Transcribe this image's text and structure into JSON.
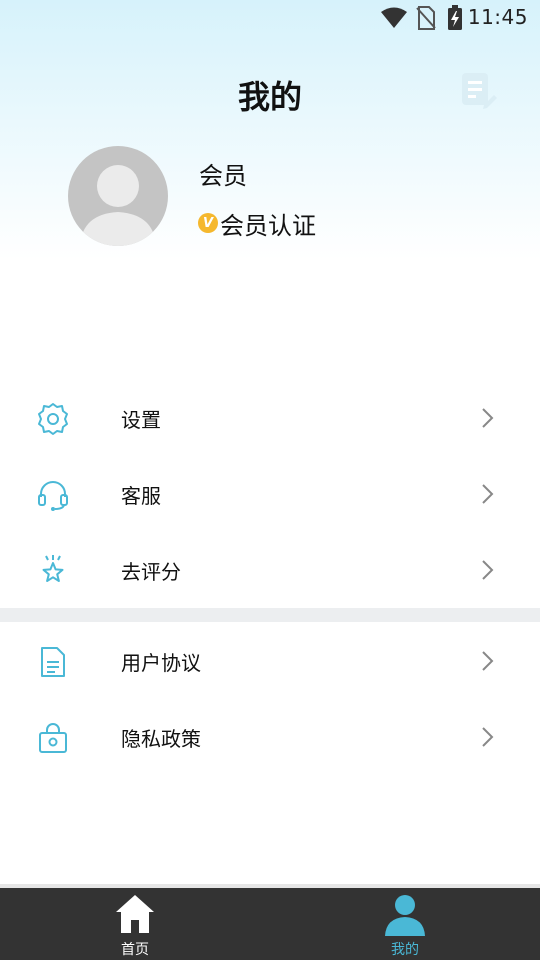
{
  "status_bar": {
    "time": "11:45"
  },
  "header": {
    "title": "我的"
  },
  "profile": {
    "username": "会员",
    "badge_letter": "V",
    "membership_label": "会员认证"
  },
  "menu": {
    "group1": [
      {
        "label": "设置",
        "icon": "gear-icon"
      },
      {
        "label": "客服",
        "icon": "headset-icon"
      },
      {
        "label": "去评分",
        "icon": "star-icon"
      }
    ],
    "group2": [
      {
        "label": "用户协议",
        "icon": "document-icon"
      },
      {
        "label": "隐私政策",
        "icon": "lock-icon"
      }
    ]
  },
  "bottom_nav": {
    "tabs": [
      {
        "label": "首页",
        "icon": "home-icon",
        "active": false
      },
      {
        "label": "我的",
        "icon": "person-icon",
        "active": true
      }
    ]
  },
  "colors": {
    "accent": "#4ab8d6",
    "badge": "#f5b82e",
    "nav_background": "#333333",
    "nav_active": "#4ab8d6",
    "nav_inactive": "#ffffff"
  }
}
